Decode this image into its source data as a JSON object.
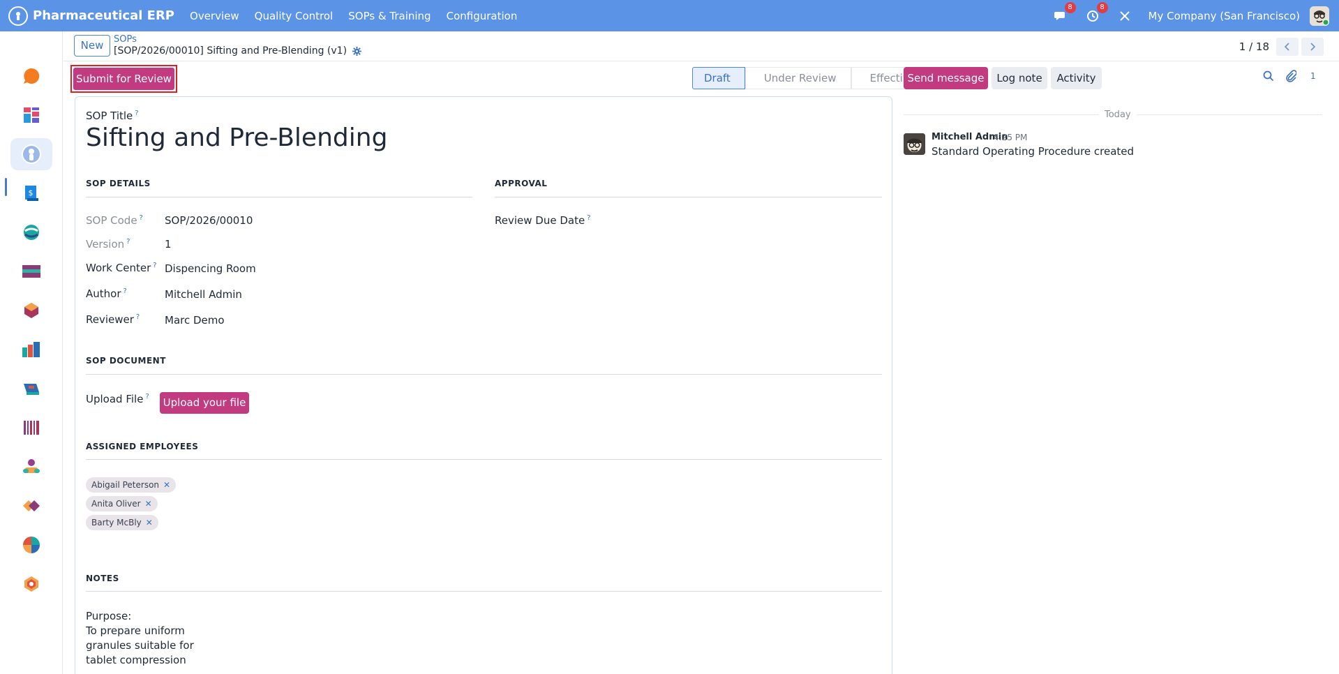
{
  "app": {
    "brand": "Pharmaceutical ERP",
    "menu": [
      "Overview",
      "Quality Control",
      "SOPs & Training",
      "Configuration"
    ],
    "messages_badge": "8",
    "activities_badge": "8",
    "company": "My Company (San Francisco)"
  },
  "sidebar": {
    "apps": [
      "discuss",
      "dashboards",
      "pharmaceutical-erp",
      "invoicing",
      "project",
      "payroll",
      "inventory",
      "manufacturing",
      "point-of-sale",
      "barcode",
      "employees",
      "sign",
      "documents",
      "quality"
    ]
  },
  "control_panel": {
    "new_label": "New",
    "breadcrumb_parent": "SOPs",
    "breadcrumb_current": "[SOP/2026/00010] Sifting and Pre-Blending (v1)",
    "pager": "1 / 18"
  },
  "actions": {
    "submit_label": "Submit for Review"
  },
  "statusbar": {
    "stages": [
      "Draft",
      "Under Review",
      "Effective"
    ],
    "active": "Draft"
  },
  "form": {
    "title_label": "SOP Title",
    "title_value": "Sifting and Pre-Blending",
    "sections": {
      "details": "SOP DETAILS",
      "approval": "APPROVAL",
      "document": "SOP DOCUMENT",
      "employees": "ASSIGNED EMPLOYEES",
      "notes": "NOTES"
    },
    "fields": {
      "sop_code_label": "SOP Code",
      "sop_code_value": "SOP/2026/00010",
      "version_label": "Version",
      "version_value": "1",
      "work_center_label": "Work Center",
      "work_center_value": "Dispencing Room",
      "author_label": "Author",
      "author_value": "Mitchell Admin",
      "reviewer_label": "Reviewer",
      "reviewer_value": "Marc Demo",
      "review_due_label": "Review Due Date",
      "upload_label": "Upload File",
      "upload_button": "Upload your file"
    },
    "employees": [
      "Abigail Peterson",
      "Anita Oliver",
      "Barty McBly"
    ],
    "notes": "Purpose:\nTo prepare uniform\ngranules suitable for\ntablet compression"
  },
  "chatter": {
    "send_message": "Send message",
    "log_note": "Log note",
    "activity": "Activity",
    "followers_count": "1",
    "date_separator": "Today",
    "message": {
      "author": "Mitchell Admin",
      "time": "4:25 PM",
      "body": "Standard Operating Procedure created"
    }
  },
  "colors": {
    "navbar": "#5b93e6",
    "primary": "#c23a80",
    "link": "#3a72c6"
  }
}
